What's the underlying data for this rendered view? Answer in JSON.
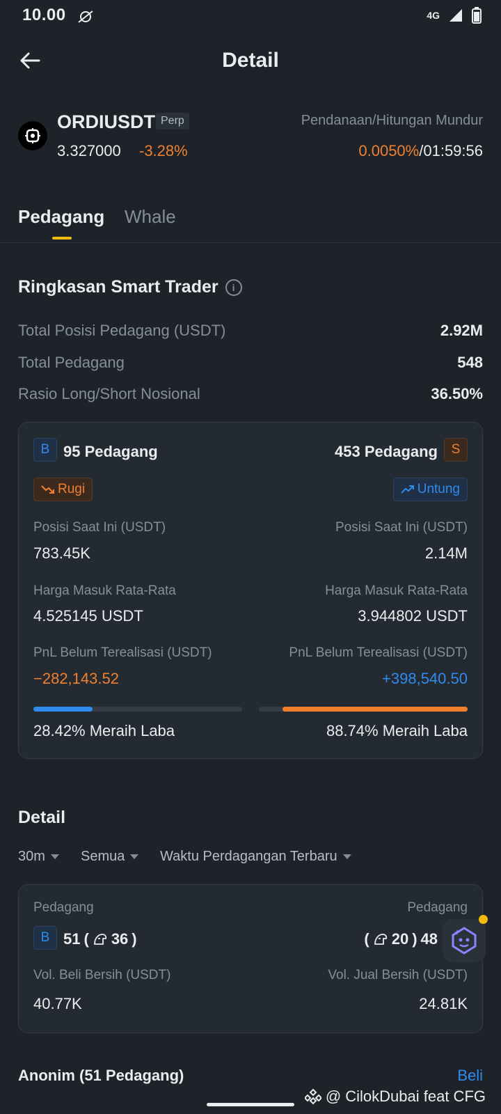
{
  "status_bar": {
    "time": "10.00",
    "network": "4G"
  },
  "header": {
    "title": "Detail"
  },
  "ticker": {
    "symbol": "ORDIUSDT",
    "contract_tag": "Perp",
    "price": "3.327000",
    "change": "-3.28%",
    "funding_label": "Pendanaan/Hitungan Mundur",
    "funding_rate": "0.0050%",
    "separator": "/",
    "countdown": "01:59:56"
  },
  "tabs": [
    {
      "label": "Pedagang",
      "active": true
    },
    {
      "label": "Whale",
      "active": false
    }
  ],
  "summary": {
    "title": "Ringkasan Smart Trader",
    "rows": [
      {
        "label": "Total Posisi Pedagang (USDT)",
        "value": "2.92M"
      },
      {
        "label": "Total Pedagang",
        "value": "548"
      },
      {
        "label": "Rasio Long/Short Nosional",
        "value": "36.50%"
      }
    ]
  },
  "long_short": {
    "long": {
      "badge": "B",
      "traders": "95 Pedagang",
      "pill": "Rugi",
      "pos_label": "Posisi Saat Ini (USDT)",
      "pos_value": "783.45K",
      "entry_label": "Harga Masuk Rata-Rata",
      "entry_value": "4.525145 USDT",
      "pnl_label": "PnL Belum Terealisasi (USDT)",
      "pnl_value": "−282,143.52",
      "win_rate": 0.2842,
      "win_text": "28.42% Meraih Laba"
    },
    "short": {
      "badge": "S",
      "traders": "453 Pedagang",
      "pill": "Untung",
      "pos_label": "Posisi Saat Ini (USDT)",
      "pos_value": "2.14M",
      "entry_label": "Harga Masuk Rata-Rata",
      "entry_value": "3.944802 USDT",
      "pnl_label": "PnL Belum Terealisasi (USDT)",
      "pnl_value": "+398,540.50",
      "win_rate": 0.8874,
      "win_text": "88.74% Meraih Laba"
    }
  },
  "detail": {
    "title": "Detail",
    "filters": [
      "30m",
      "Semua",
      "Waktu Perdagangan Terbaru"
    ],
    "card": {
      "left_label": "Pedagang",
      "right_label": "Pedagang",
      "badge": "B",
      "buy_count": "51",
      "buy_smart": "36",
      "sell_smart": "20",
      "sell_count": "48",
      "buy_vol_label": "Vol. Beli Bersih (USDT)",
      "buy_vol": "40.77K",
      "sell_vol_label": "Vol. Jual Bersih (USDT)",
      "sell_vol": "24.81K"
    }
  },
  "bottom": {
    "title": "Anonim (51 Pedagang)",
    "action": "Beli"
  },
  "watermark": "@ CilokDubai feat CFG",
  "colors": {
    "bg": "#1e2329",
    "accent": "#f0b90b",
    "buy": "#2f8bed",
    "sell": "#f0802e"
  }
}
